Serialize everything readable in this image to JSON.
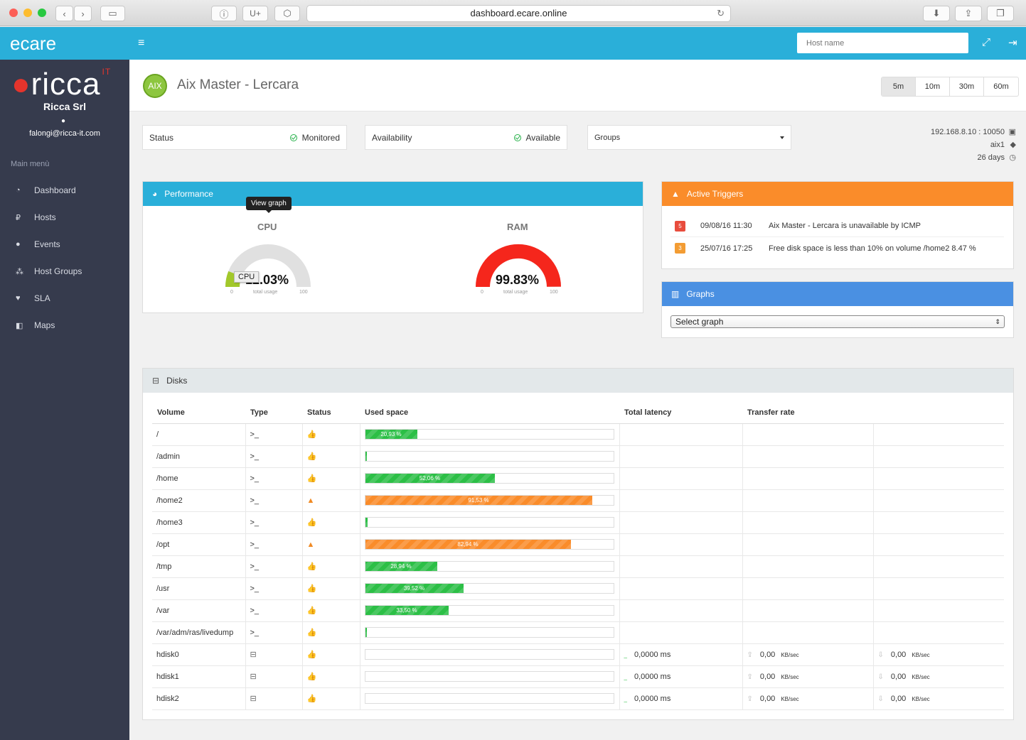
{
  "browser": {
    "url": "dashboard.ecare.online"
  },
  "topbar": {
    "brand": "ecare",
    "host_search_placeholder": "Host name"
  },
  "sidebar": {
    "brand": "ricca",
    "brand_suffix": "IT",
    "company": "Ricca Srl",
    "email": "falongi@ricca-it.com",
    "menu_title": "Main menù",
    "items": [
      {
        "label": "Dashboard",
        "icon": "dashboard-icon"
      },
      {
        "label": "Hosts",
        "icon": "hosts-icon"
      },
      {
        "label": "Events",
        "icon": "events-icon"
      },
      {
        "label": "Host Groups",
        "icon": "host-groups-icon"
      },
      {
        "label": "SLA",
        "icon": "sla-icon"
      },
      {
        "label": "Maps",
        "icon": "maps-icon"
      }
    ]
  },
  "host": {
    "os_badge": "AIX",
    "title": "Aix Master - Lercara",
    "ranges": [
      "5m",
      "10m",
      "30m",
      "60m"
    ],
    "active_range": "5m",
    "status_label": "Status",
    "status_value": "Monitored",
    "availability_label": "Availability",
    "availability_value": "Available",
    "groups_label": "Groups",
    "address": "192.168.8.10 : 10050",
    "tag": "aix1",
    "uptime": "26 days"
  },
  "performance": {
    "title": "Performance",
    "tooltip": "View graph",
    "cpu": {
      "title": "CPU",
      "value_text": "12.03%",
      "value": 12.03,
      "min": "0",
      "max": "100",
      "caption": "total usage",
      "hover_label": "CPU"
    },
    "ram": {
      "title": "RAM",
      "value_text": "99.83%",
      "value": 99.83,
      "min": "0",
      "max": "100",
      "caption": "total usage"
    }
  },
  "triggers": {
    "title": "Active Triggers",
    "items": [
      {
        "severity": "5",
        "color": "#e84c3d",
        "date": "09/08/16 11:30",
        "text": "Aix Master - Lercara is unavailable by ICMP"
      },
      {
        "severity": "3",
        "color": "#f39c33",
        "date": "25/07/16 17:25",
        "text": "Free disk space is less than 10% on volume /home2 8.47 %"
      }
    ]
  },
  "graphs": {
    "title": "Graphs",
    "select_placeholder": "Select graph"
  },
  "disks": {
    "title": "Disks",
    "columns": [
      "Volume",
      "Type",
      "Status",
      "Used space",
      "Total latency",
      "Transfer rate"
    ],
    "rows": [
      {
        "volume": "/",
        "type": ">_",
        "status": "ok",
        "used": 20.93,
        "used_label": "20,93 %"
      },
      {
        "volume": "/admin",
        "type": ">_",
        "status": "ok",
        "used": 0.5,
        "used_label": ""
      },
      {
        "volume": "/home",
        "type": ">_",
        "status": "ok",
        "used": 52.06,
        "used_label": "52,06 %"
      },
      {
        "volume": "/home2",
        "type": ">_",
        "status": "warn",
        "used": 91.53,
        "used_label": "91,53 %"
      },
      {
        "volume": "/home3",
        "type": ">_",
        "status": "ok",
        "used": 1,
        "used_label": ""
      },
      {
        "volume": "/opt",
        "type": ">_",
        "status": "warn",
        "used": 82.94,
        "used_label": "82,94 %"
      },
      {
        "volume": "/tmp",
        "type": ">_",
        "status": "ok",
        "used": 28.94,
        "used_label": "28,94 %"
      },
      {
        "volume": "/usr",
        "type": ">_",
        "status": "ok",
        "used": 39.52,
        "used_label": "39,52 %"
      },
      {
        "volume": "/var",
        "type": ">_",
        "status": "ok",
        "used": 33.5,
        "used_label": "33,50 %"
      },
      {
        "volume": "/var/adm/ras/livedump",
        "type": ">_",
        "status": "ok",
        "used": 0.5,
        "used_label": ""
      },
      {
        "volume": "hdisk0",
        "type": "disk",
        "status": "ok",
        "used": 0,
        "used_label": "",
        "latency": "0,0000 ms",
        "read": "0,00",
        "write": "0,00",
        "unit": "KB/sec"
      },
      {
        "volume": "hdisk1",
        "type": "disk",
        "status": "ok",
        "used": 0,
        "used_label": "",
        "latency": "0,0000 ms",
        "read": "0,00",
        "write": "0,00",
        "unit": "KB/sec"
      },
      {
        "volume": "hdisk2",
        "type": "disk",
        "status": "ok",
        "used": 0,
        "used_label": "",
        "latency": "0,0000 ms",
        "read": "0,00",
        "write": "0,00",
        "unit": "KB/sec"
      }
    ]
  },
  "colors": {
    "topbar": "#2aafd9",
    "sidebar": "#363b4d",
    "performance": "#2aafd9",
    "triggers": "#fa8c2a",
    "graphs": "#4a90e2",
    "ok": "#2cbf46",
    "warn": "#fa8c2a"
  }
}
